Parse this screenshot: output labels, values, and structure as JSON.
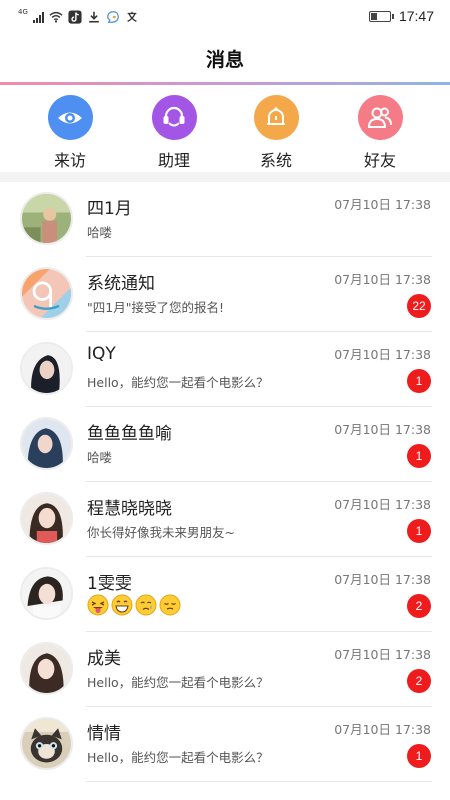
{
  "status_bar": {
    "network": "4G",
    "time": "17:47",
    "battery_level": 0.35,
    "icons": [
      "signal-icon",
      "wifi-icon",
      "tiktok-icon",
      "download-icon",
      "bubble-app-icon",
      "translate-icon"
    ]
  },
  "header": {
    "title": "消息"
  },
  "quick_actions": [
    {
      "label": "来访",
      "icon": "eye-icon",
      "color": "#4f8ff2"
    },
    {
      "label": "助理",
      "icon": "headset-icon",
      "color": "#a356e6"
    },
    {
      "label": "系统",
      "icon": "bell-icon",
      "color": "#f5a84a"
    },
    {
      "label": "好友",
      "icon": "people-icon",
      "color": "#f57c86"
    }
  ],
  "conversations": [
    {
      "name": "四1月",
      "preview": "哈喽",
      "time": "07月10日 17:38",
      "unread": ""
    },
    {
      "name": "系统通知",
      "preview": "\"四1月\"接受了您的报名!",
      "time": "07月10日 17:38",
      "unread": "22"
    },
    {
      "name": "IQY",
      "preview": "Hello，能约您一起看个电影么？",
      "time": "07月10日 17:38",
      "unread": "1"
    },
    {
      "name": "鱼鱼鱼鱼喻",
      "preview": "哈喽",
      "time": "07月10日 17:38",
      "unread": "1"
    },
    {
      "name": "程慧晓晓晓",
      "preview": "你长得好像我未来男朋友~",
      "time": "07月10日 17:38",
      "unread": "1"
    },
    {
      "name": "1雯雯",
      "preview": "",
      "emojis": [
        "squinting-tongue-emoji",
        "grinning-emoji",
        "crying-emoji",
        "pensive-emoji"
      ],
      "time": "07月10日 17:38",
      "unread": "2"
    },
    {
      "name": "成美",
      "preview": "Hello，能约您一起看个电影么？",
      "time": "07月10日 17:38",
      "unread": "2"
    },
    {
      "name": "情情",
      "preview": "Hello，能约您一起看个电影么？",
      "time": "07月10日 17:38",
      "unread": "1"
    }
  ]
}
